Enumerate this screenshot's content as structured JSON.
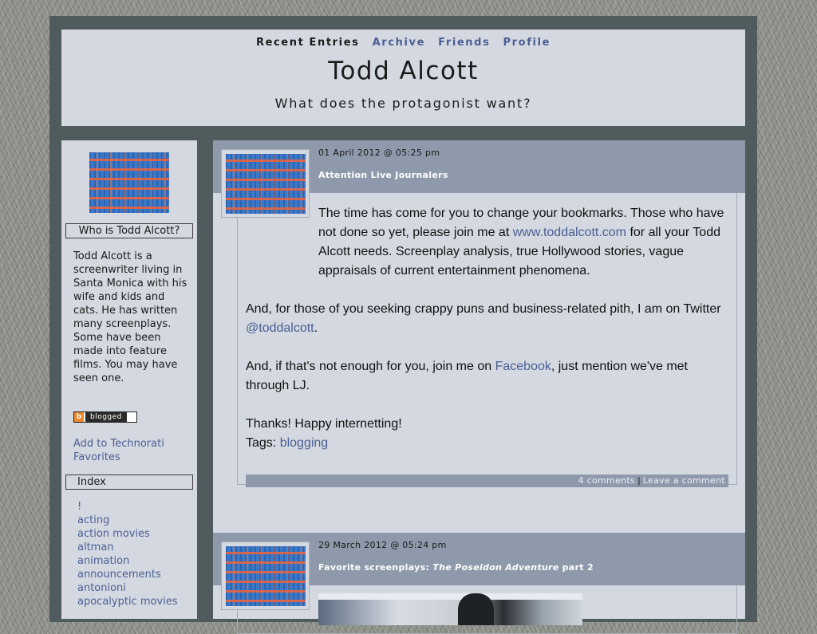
{
  "nav": {
    "recent": "Recent Entries",
    "archive": "Archive",
    "friends": "Friends",
    "profile": "Profile"
  },
  "site": {
    "title": "Todd Alcott",
    "tagline": "What does the protagonist want?"
  },
  "sidebar": {
    "who_heading": "Who is Todd Alcott?",
    "bio": "Todd Alcott is a screenwriter living in Santa Monica with his wife and kids and cats. He has written many screenplays. Some have been made into feature films. You may have seen one.",
    "badge_b": "b",
    "badge_text": "blogged",
    "technorati": "Add to Technorati Favorites",
    "index_heading": "Index",
    "tags": [
      "!",
      "acting",
      "action movies",
      "altman",
      "animation",
      "announcements",
      "antonioni",
      "apocalyptic movies"
    ]
  },
  "entries": [
    {
      "date": "01 April 2012 @ 05:25 pm",
      "subject": "Attention Live Journalers",
      "p1_a": "The time has come for you to change your bookmarks.  Those who have not done so yet, please join me at ",
      "p1_link": "www.toddalcott.com",
      "p1_b": " for all your Todd Alcott needs.  Screenplay analysis, true Hollywood stories, vague appraisals of current entertainment phenomena.",
      "p2_a": "And, for those of you seeking crappy puns and business-related pith, I am on Twitter ",
      "p2_link": "@toddalcott",
      "p2_b": ".",
      "p3_a": "And, if that's not enough for you, join me on ",
      "p3_link": "Facebook",
      "p3_b": ", just mention we've met through LJ.",
      "p4": "Thanks!  Happy internetting!",
      "tags_label": "Tags: ",
      "tag": "blogging",
      "comments": "4 comments",
      "separator": "|",
      "leave_comment": "Leave a comment"
    },
    {
      "date": "29 March 2012 @ 05:24 pm",
      "subject_a": "Favorite screenplays: ",
      "subject_italic": "The Poseidon Adventure",
      "subject_b": " part 2"
    }
  ]
}
